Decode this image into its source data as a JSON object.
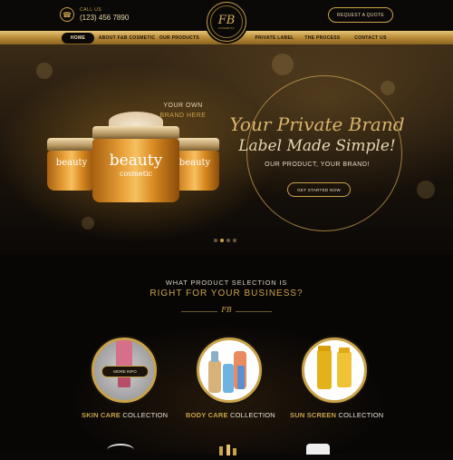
{
  "header": {
    "call_label": "CALL US",
    "phone": "(123) 456 7890",
    "logo_monogram": "FB",
    "logo_sub": "COSMETIC",
    "quote_button": "REQUEST A QUOTE"
  },
  "nav": {
    "items": [
      {
        "label": "HOME",
        "active": true
      },
      {
        "label": "ABOUT F&B COSMETIC"
      },
      {
        "label": "OUR PRODUCTS"
      },
      {
        "label": "PRIVATE LABEL"
      },
      {
        "label": "THE PROCESS"
      },
      {
        "label": "CONTACT US"
      }
    ]
  },
  "hero": {
    "jar_text": "beauty",
    "jar_subtext": "cosmetic",
    "brand_line1": "YOUR OWN",
    "brand_line2": "BRAND HERE",
    "headline1": "Your Private Brand",
    "headline2": "Label Made Simple!",
    "tagline": "OUR PRODUCT, YOUR BRAND!",
    "cta_button": "GET STARTED NOW",
    "slides_total": 4,
    "active_slide": 1
  },
  "section": {
    "title_line1": "WHAT PRODUCT SELECTION IS",
    "title_line2": "RIGHT FOR YOUR BUSINESS?",
    "divider_mono": "FB",
    "more_button": "MORE INFO",
    "collections": [
      {
        "name": "SKIN CARE",
        "suffix": "COLLECTION"
      },
      {
        "name": "BODY CARE",
        "suffix": "COLLECTION"
      },
      {
        "name": "SUN SCREEN",
        "suffix": "COLLECTION"
      }
    ]
  },
  "colors": {
    "gold": "#c9a24a",
    "dark": "#0b0907"
  }
}
